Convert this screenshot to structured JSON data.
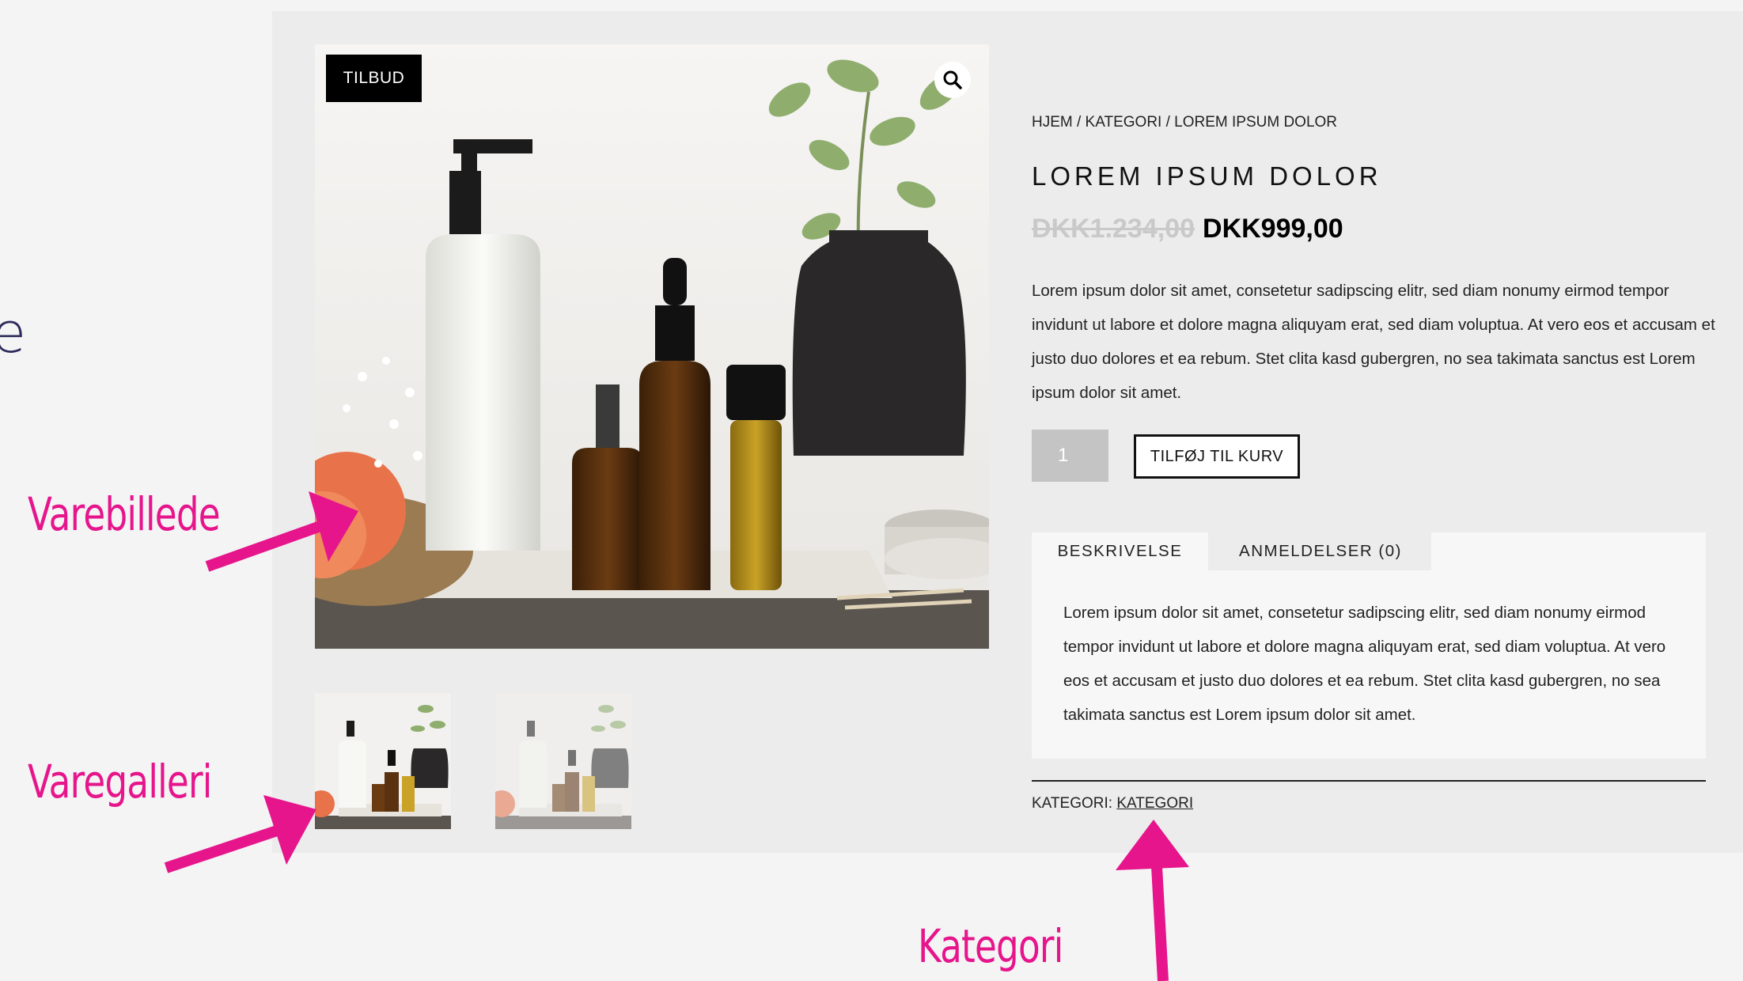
{
  "edge_glyph": "e",
  "badge": {
    "label": "TILBUD"
  },
  "zoom": {
    "icon": "magnifier-icon"
  },
  "breadcrumb": "HJEM / KATEGORI / LOREM IPSUM DOLOR",
  "product": {
    "title": "LOREM IPSUM DOLOR",
    "price_old": "DKK1.234,00",
    "price_new": "DKK999,00",
    "short_description": "Lorem ipsum dolor sit amet, consetetur sadipscing elitr, sed diam nonumy eirmod tempor invidunt ut labore et dolore magna aliquyam erat, sed diam voluptua. At vero eos et accusam et justo duo dolores et ea rebum. Stet clita kasd gubergren, no sea takimata sanctus est Lorem ipsum dolor sit amet."
  },
  "cart": {
    "quantity": "1",
    "add_label": "TILFØJ TIL KURV"
  },
  "tabs": [
    {
      "label": "BESKRIVELSE",
      "active": true
    },
    {
      "label": "ANMELDELSER (0)",
      "active": false
    }
  ],
  "tab_content": "Lorem ipsum dolor sit amet, consetetur sadipscing elitr, sed diam nonumy eirmod tempor invidunt ut labore et dolore magna aliquyam erat, sed diam voluptua. At vero eos et accusam et justo duo dolores et ea rebum. Stet clita kasd gubergren, no sea takimata sanctus est Lorem ipsum dolor sit amet.",
  "meta": {
    "category_label": "KATEGORI:",
    "category_link": "KATEGORI"
  },
  "annotations": {
    "main_image": "Varebillede",
    "gallery": "Varegalleri",
    "category": "Kategori"
  },
  "colors": {
    "annotation": "#e6158c",
    "panel": "#ececec",
    "background": "#f4f4f4",
    "badge": "#000000"
  }
}
